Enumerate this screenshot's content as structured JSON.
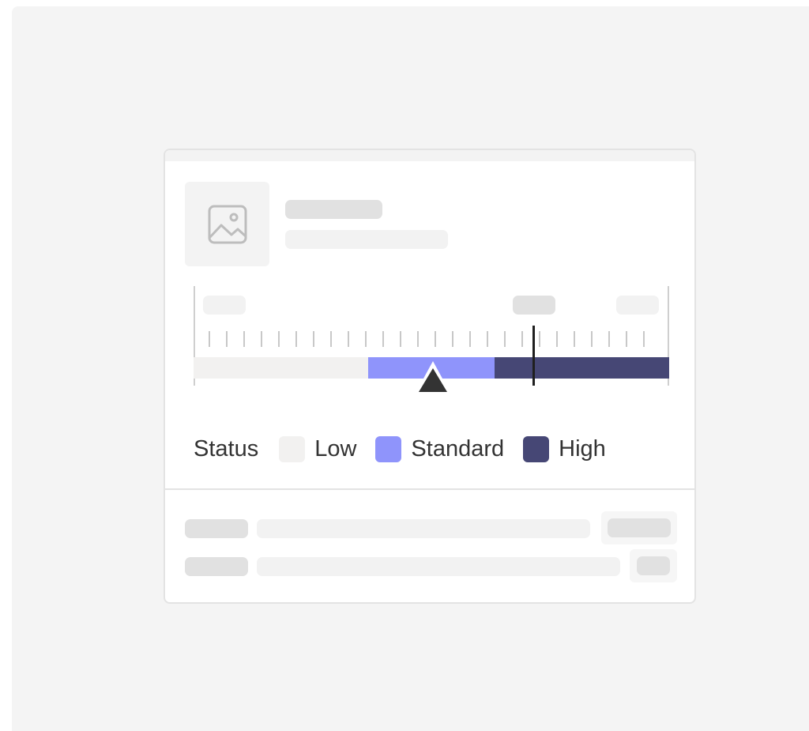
{
  "legend": {
    "title": "Status",
    "items": [
      {
        "label": "Low",
        "color": "#f2f1f0"
      },
      {
        "label": "Standard",
        "color": "#8f94fb"
      },
      {
        "label": "High",
        "color": "#464775"
      }
    ]
  },
  "gauge": {
    "value_fraction": 0.504,
    "marker_fraction": 0.714,
    "segments": [
      {
        "name": "Low",
        "start": 0.0,
        "end": 0.367,
        "color": "#f2f1f0"
      },
      {
        "name": "Standard",
        "start": 0.367,
        "end": 0.633,
        "color": "#8f94fb"
      },
      {
        "name": "High",
        "start": 0.633,
        "end": 1.0,
        "color": "#464775"
      }
    ]
  },
  "icons": {
    "thumbnail": "image-icon",
    "pointer": "triangle-pointer-icon"
  }
}
